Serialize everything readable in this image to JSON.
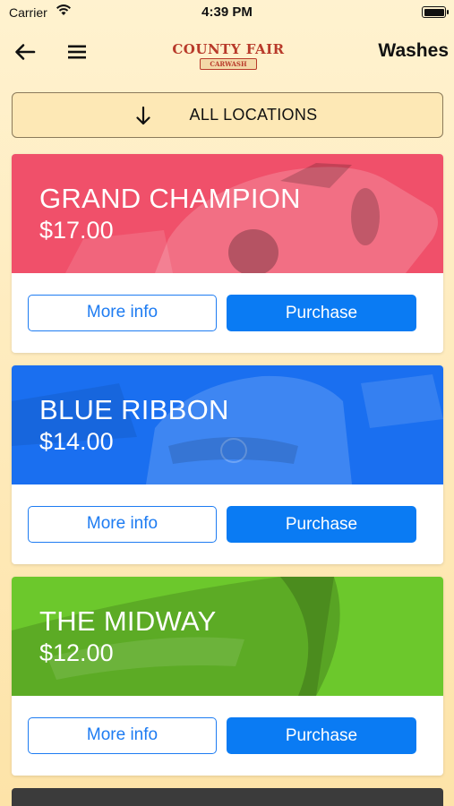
{
  "status_bar": {
    "carrier": "Carrier",
    "time": "4:39 PM"
  },
  "nav": {
    "title": "Washes",
    "logo_title": "COUNTY FAIR",
    "logo_subtitle": "CARWASH",
    "back_icon": "arrow-left-icon",
    "menu_icon": "hamburger-menu-icon"
  },
  "location_filter": {
    "label": "ALL LOCATIONS",
    "icon": "arrow-down-icon"
  },
  "washes": [
    {
      "name": "GRAND CHAMPION",
      "price": "$17.00",
      "color": "#f0506a",
      "more_info": "More info",
      "purchase": "Purchase"
    },
    {
      "name": "BLUE RIBBON",
      "price": "$14.00",
      "color": "#1a6ff0",
      "more_info": "More info",
      "purchase": "Purchase"
    },
    {
      "name": "THE MIDWAY",
      "price": "$12.00",
      "color": "#6cc82c",
      "more_info": "More info",
      "purchase": "Purchase"
    }
  ],
  "colors": {
    "accent": "#0a7bf3",
    "background": "#fde8b5"
  }
}
